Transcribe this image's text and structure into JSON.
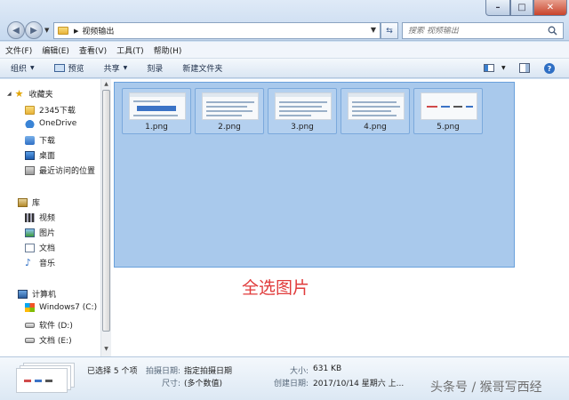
{
  "address": {
    "path": "视频输出",
    "search_placeholder": "搜索 视频输出"
  },
  "window_controls": {
    "minimize": "–",
    "maximize": "□",
    "close": "✕"
  },
  "menu": [
    "文件(F)",
    "编辑(E)",
    "查看(V)",
    "工具(T)",
    "帮助(H)"
  ],
  "toolbar": {
    "organize": "组织",
    "preview": "预览",
    "share": "共享",
    "burn": "刻录",
    "new_folder": "新建文件夹"
  },
  "nav": {
    "favorites_header": "收藏夹",
    "favorites": [
      "2345下载",
      "OneDrive",
      "下载",
      "桌面",
      "最近访问的位置"
    ],
    "libraries_header": "库",
    "libraries": [
      "视频",
      "图片",
      "文档",
      "音乐"
    ],
    "computer_header": "计算机",
    "drives": [
      "Windows7 (C:)",
      "软件 (D:)",
      "文档 (E:)"
    ]
  },
  "files": [
    "1.png",
    "2.png",
    "3.png",
    "4.png",
    "5.png"
  ],
  "annotation": "全选图片",
  "details": {
    "selected": "已选择 5 个项",
    "date_taken_label": "拍摄日期:",
    "date_taken_value": "指定拍摄日期",
    "dimensions_label": "尺寸:",
    "dimensions_value": "(多个数值)",
    "size_label": "大小:",
    "size_value": "631 KB",
    "created_label": "创建日期:",
    "created_value": "2017/10/14 星期六 上..."
  },
  "watermark": "头条号 / 猴哥写西经"
}
